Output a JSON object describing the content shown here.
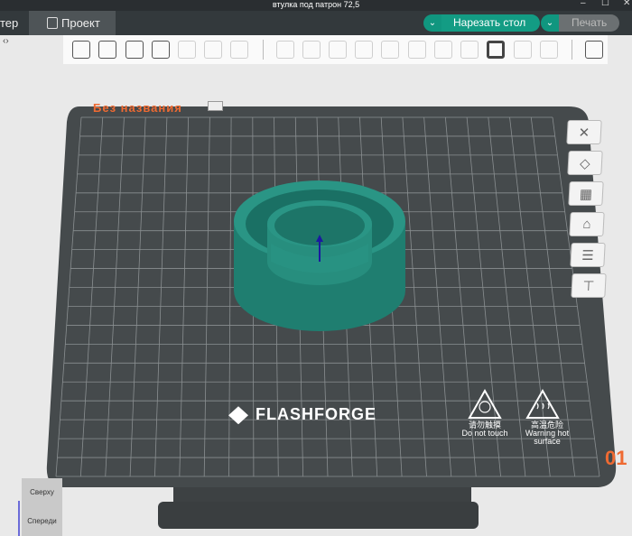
{
  "window": {
    "title": "втулка под патрон 72,5",
    "minimize": "–",
    "maximize": "☐",
    "close": "✕"
  },
  "tabs": [
    {
      "label": "тер"
    },
    {
      "label": "Проект",
      "icon": "list-icon"
    }
  ],
  "actions": {
    "slice_label": "Нарезать стол",
    "print_label": "Печать",
    "dropdown": "⌄"
  },
  "toolbar": {
    "icons": [
      "add-model-icon",
      "add-grid-icon",
      "auto-place-icon",
      "plate-layout-icon",
      "arrange-icon",
      "split-icon",
      "layers-icon",
      "move-icon",
      "rotate-icon",
      "scale-icon",
      "place-face-icon",
      "cut-icon",
      "mirror-icon",
      "paint-icon",
      "seam-icon",
      "text-icon",
      "measure-icon",
      "support-icon",
      "assemble-icon"
    ]
  },
  "collapse_label": "‹›",
  "plate": {
    "name": "Без названия",
    "brand": "FLASHFORGE",
    "counter": "01",
    "warnings": [
      {
        "cn": "请勿触摸",
        "en": "Do not touch"
      },
      {
        "cn": "高温危险",
        "en": "Warning hot surface"
      }
    ]
  },
  "right_tools": [
    {
      "icon": "delete-icon",
      "glyph": "✕"
    },
    {
      "icon": "auto-orient-icon",
      "glyph": "◇"
    },
    {
      "icon": "arrange-icon",
      "glyph": "▦"
    },
    {
      "icon": "lock-icon",
      "glyph": "⌂"
    },
    {
      "icon": "settings-sliders-icon",
      "glyph": "☰"
    },
    {
      "icon": "lay-flat-icon",
      "glyph": "⊤"
    }
  ],
  "model": {
    "color": "#1f8a7a"
  },
  "view_cube": {
    "top": "Сверху",
    "front": "Спереди"
  }
}
